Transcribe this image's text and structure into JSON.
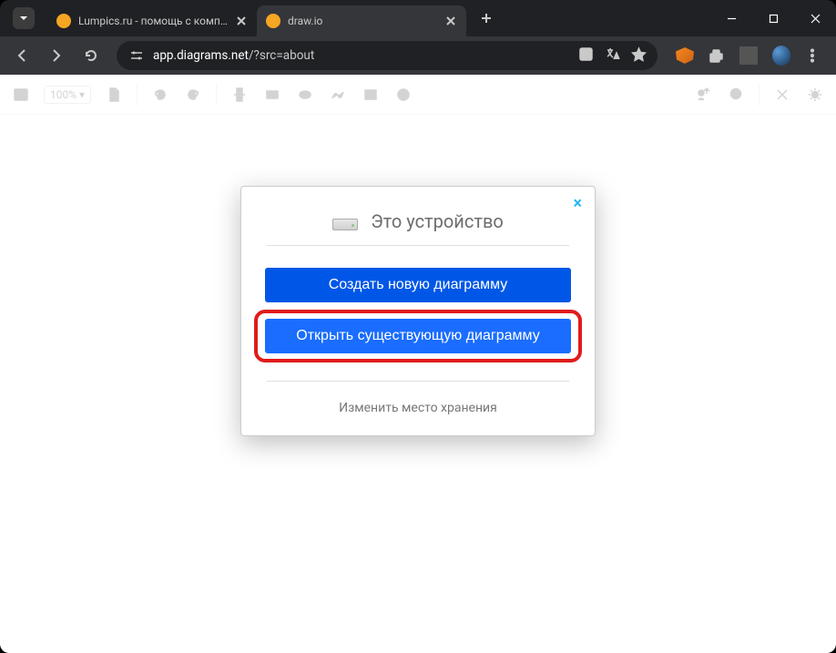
{
  "tabs": [
    {
      "title": "Lumpics.ru - помощь с компью",
      "favicon_color": "#f5a623"
    },
    {
      "title": "draw.io",
      "favicon_color": "#f5a623"
    }
  ],
  "url": {
    "domain": "app.diagrams.net",
    "path": "/?src=about"
  },
  "app_toolbar": {
    "zoom": "100%"
  },
  "modal": {
    "title": "Это устройство",
    "create": "Создать новую диаграмму",
    "open": "Открыть существующую диаграмму",
    "change_storage": "Изменить место хранения"
  }
}
